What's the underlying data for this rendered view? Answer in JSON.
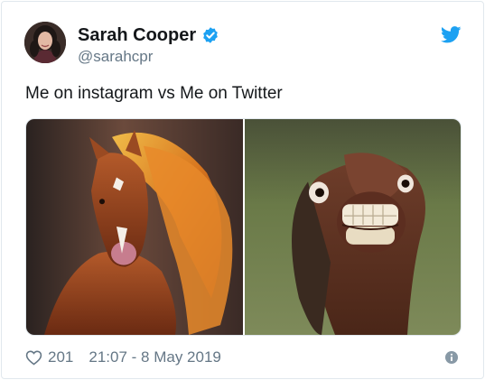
{
  "tweet": {
    "author": {
      "display_name": "Sarah Cooper",
      "handle": "@sarahcpr",
      "verified": true,
      "avatar": "profile-photo"
    },
    "text": "Me on instagram vs Me on Twitter",
    "media": [
      {
        "description": "horse-with-flowing-mane-photo"
      },
      {
        "description": "horse-grinning-photo"
      }
    ],
    "likes": "201",
    "timestamp": "21:07 - 8 May 2019"
  },
  "icons": {
    "brand": "twitter-bird-icon",
    "verified": "verified-badge-icon",
    "like": "heart-icon",
    "info": "info-icon"
  },
  "colors": {
    "twitter_blue": "#1da1f2",
    "text": "#14171a",
    "secondary_text": "#657786",
    "border": "#e1e8ed"
  }
}
